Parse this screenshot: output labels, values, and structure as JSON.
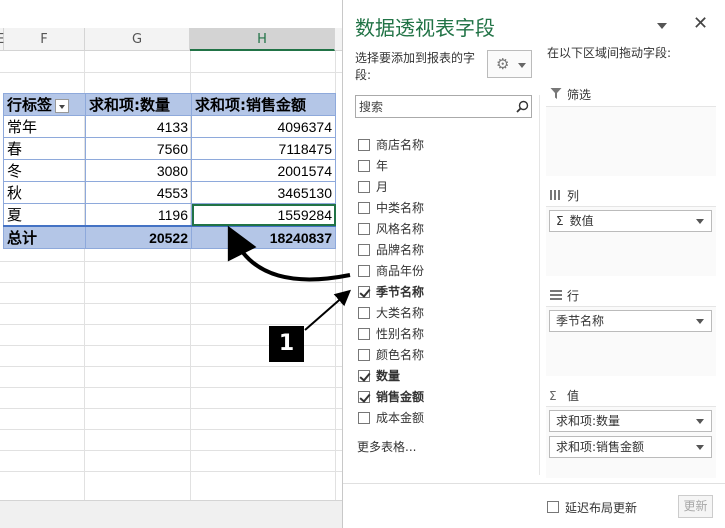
{
  "sheet": {
    "columns": [
      {
        "label": "E"
      },
      {
        "label": "F"
      },
      {
        "label": "G"
      },
      {
        "label": "H"
      }
    ],
    "pivot": {
      "headers": [
        "行标签",
        "求和项:数量",
        "求和项:销售金额"
      ],
      "rows": [
        {
          "label": "常年",
          "qty": "4133",
          "amount": "4096374"
        },
        {
          "label": "春",
          "qty": "7560",
          "amount": "7118475"
        },
        {
          "label": "冬",
          "qty": "3080",
          "amount": "2001574"
        },
        {
          "label": "秋",
          "qty": "4553",
          "amount": "3465130"
        },
        {
          "label": "夏",
          "qty": "1196",
          "amount": "1559284"
        }
      ],
      "total": {
        "label": "总计",
        "qty": "20522",
        "amount": "18240837"
      }
    }
  },
  "panel": {
    "title": "数据透视表字段",
    "close_glyph": "✕",
    "choose_label": "选择要添加到报表的字段:",
    "gear_glyph": "⚙",
    "search_placeholder": "搜索",
    "fields": [
      {
        "label": "商店名称",
        "checked": false
      },
      {
        "label": "年",
        "checked": false
      },
      {
        "label": "月",
        "checked": false
      },
      {
        "label": "中类名称",
        "checked": false
      },
      {
        "label": "风格名称",
        "checked": false
      },
      {
        "label": "品牌名称",
        "checked": false
      },
      {
        "label": "商品年份",
        "checked": false
      },
      {
        "label": "季节名称",
        "checked": true
      },
      {
        "label": "大类名称",
        "checked": false
      },
      {
        "label": "性别名称",
        "checked": false
      },
      {
        "label": "颜色名称",
        "checked": false
      },
      {
        "label": "数量",
        "checked": true
      },
      {
        "label": "销售金额",
        "checked": true
      },
      {
        "label": "成本金额",
        "checked": false
      }
    ],
    "more_tables": "更多表格...",
    "areas_label": "在以下区域间拖动字段:",
    "areas": {
      "filters": {
        "title": "筛选",
        "icon": "filter-icon"
      },
      "columns": {
        "title": "列",
        "icon": "columns-icon",
        "items": [
          "数值"
        ]
      },
      "rows": {
        "title": "行",
        "icon": "rows-icon",
        "items": [
          "季节名称"
        ]
      },
      "values": {
        "title": "值",
        "icon": "sigma-icon",
        "items": [
          "求和项:数量",
          "求和项:销售金额"
        ]
      }
    },
    "defer_label": "延迟布局更新",
    "update_label": "更新"
  },
  "annotation": {
    "callout_number": "1"
  }
}
